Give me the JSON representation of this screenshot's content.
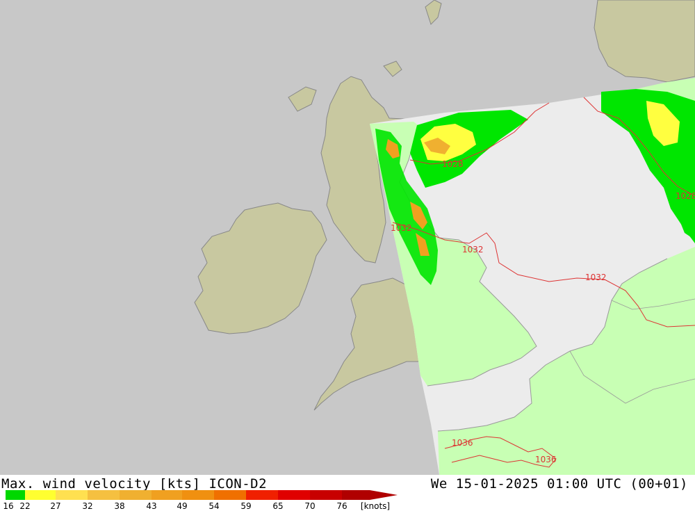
{
  "header": {
    "product": "Max. wind velocity [kts] ICON-D2",
    "valid_time": "We 15-01-2025 01:00 UTC (00+01)"
  },
  "legend": {
    "bins": [
      {
        "label": "16",
        "color": "#00d800"
      },
      {
        "label": "22",
        "color": "#ffff30"
      },
      {
        "label": "27",
        "color": "#ffe050"
      },
      {
        "label": "32",
        "color": "#f5c040"
      },
      {
        "label": "38",
        "color": "#f0b030"
      },
      {
        "label": "43",
        "color": "#f0a020"
      },
      {
        "label": "49",
        "color": "#f09010"
      },
      {
        "label": "54",
        "color": "#f07000"
      },
      {
        "label": "59",
        "color": "#f02000"
      },
      {
        "label": "65",
        "color": "#e00000"
      },
      {
        "label": "70",
        "color": "#c80000"
      },
      {
        "label": "76",
        "color": "#b00000"
      }
    ],
    "unit": "[knots]"
  },
  "isobars": [
    {
      "label": "1028"
    },
    {
      "label": "1028"
    },
    {
      "label": "1032"
    },
    {
      "label": "1032"
    },
    {
      "label": "1032"
    },
    {
      "label": "1036"
    },
    {
      "label": "1036"
    }
  ],
  "colors": {
    "sea_outside_domain": "#c8c8c8",
    "land_outside_domain": "#c8c8a0",
    "sea_inside_domain": "#ececec",
    "calm_wind_land": "#c8ffb4",
    "isobar": "#dd3333",
    "coastline": "#888888"
  }
}
